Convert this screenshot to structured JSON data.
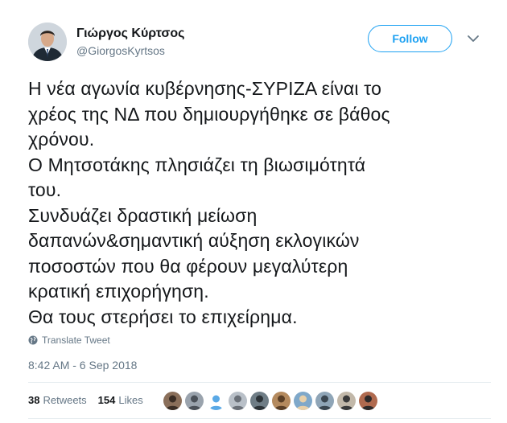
{
  "tweet": {
    "author_name": "Γιώργος Κύρτσος",
    "author_handle": "@GiorgosKyrtsos",
    "follow_label": "Follow",
    "lines": [
      "Η νέα αγωνία κυβέρνησης-ΣΥΡΙΖΑ είναι το",
      "χρέος της ΝΔ που δημιουργήθηκε σε βάθος",
      "χρόνου.",
      "Ο Μητσοτάκης πλησιάζει τη βιωσιμότητά",
      "του.",
      "Συνδυάζει δραστική μείωση",
      "δαπανών&σημαντική αύξηση εκλογικών",
      "ποσοστών που θα φέρουν μεγαλύτερη",
      "κρατική επιχορήγηση.",
      "Θα τους στερήσει το επιχείρημα."
    ],
    "translate_label": "Translate Tweet",
    "timestamp": "8:42 AM - 6 Sep 2018",
    "retweets_count": "38",
    "retweets_label": "Retweets",
    "likes_count": "154",
    "likes_label": "Likes"
  },
  "icons": {
    "caret": "chevron-down-icon",
    "translate": "globe-icon"
  },
  "colors": {
    "accent": "#1da1f2",
    "secondary_text": "#657786",
    "primary_text": "#14171a",
    "divider": "#e6ecf0"
  },
  "liker_avatars": [
    {
      "bg": "#8a6f5a",
      "fg": "#3b2e25"
    },
    {
      "bg": "#9aa3ad",
      "fg": "#4a5058"
    },
    {
      "bg": "#ffffff",
      "fg": "#5aa9e6"
    },
    {
      "bg": "#b9c0c8",
      "fg": "#6a7078"
    },
    {
      "bg": "#6f7d86",
      "fg": "#2c3338"
    },
    {
      "bg": "#b48a5e",
      "fg": "#5a3f26"
    },
    {
      "bg": "#7fa8c9",
      "fg": "#e8d0a9"
    },
    {
      "bg": "#8fa5b7",
      "fg": "#3a4650"
    },
    {
      "bg": "#c2b8a9",
      "fg": "#3a3a3a"
    },
    {
      "bg": "#b06a4f",
      "fg": "#2e2a2a"
    }
  ]
}
